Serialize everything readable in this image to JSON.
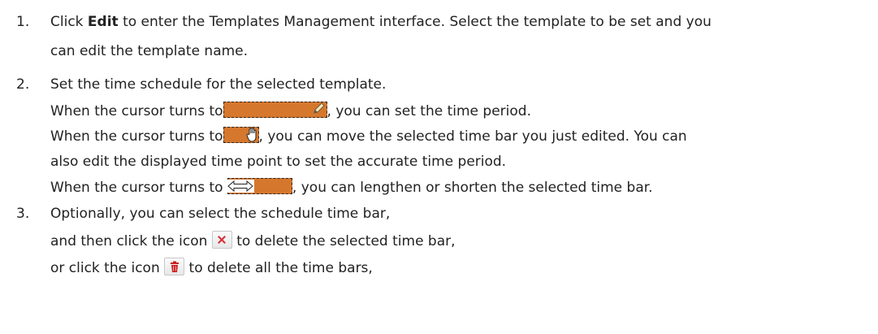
{
  "items": [
    {
      "number": "1.",
      "line1_pre": "Click ",
      "line1_bold": "Edit",
      "line1_post": " to enter the Templates Management interface. Select the template to be set and you",
      "line2": "can edit the template name."
    },
    {
      "number": "2.",
      "line1": "Set the time schedule for the selected template.",
      "pencil_pre": "When the cursor turns to",
      "pencil_post": ", you can set the time period.",
      "hand_pre": "When the cursor turns to",
      "hand_post": ", you can move the selected time bar you just edited. You can",
      "hand_line2": "also edit the displayed time point to set the accurate time period.",
      "resize_pre": "When the cursor turns to ",
      "resize_post": ", you can lengthen or shorten the selected time bar."
    },
    {
      "number": "3.",
      "line1": "Optionally, you can select the schedule time bar,",
      "delete_pre": "and then click the icon ",
      "delete_post": " to delete the selected time bar,",
      "clear_pre": "or click the icon ",
      "clear_post": " to delete all the time bars,"
    }
  ],
  "icons": {
    "pencil_cursor": "pencil-cursor-icon",
    "hand_cursor": "hand-cursor-icon",
    "resize_cursor": "resize-cursor-icon",
    "delete": "delete-x-icon",
    "delete_all": "trash-icon"
  },
  "colors": {
    "time_bar": "#d5772d",
    "delete_x": "#d8323a",
    "trash": "#c8201f"
  }
}
